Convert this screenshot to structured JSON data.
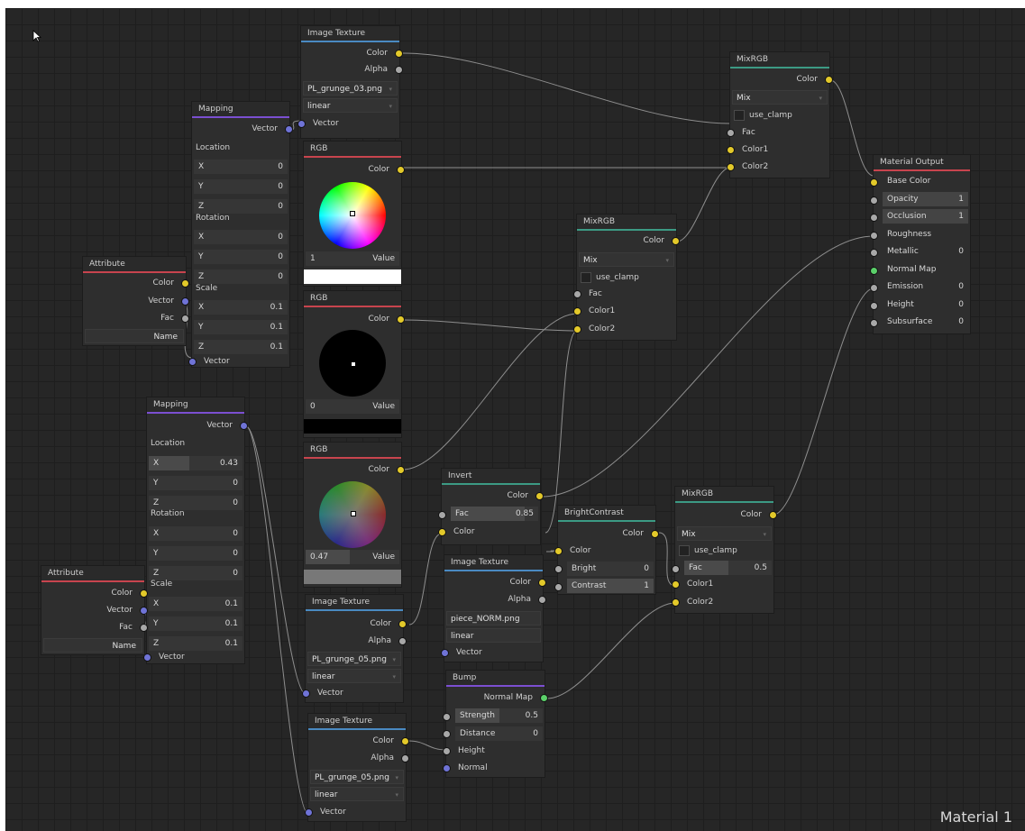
{
  "canvas_label": "Material 1",
  "cursor_icon": "arrow-cursor-icon",
  "socket_colors": {
    "color": "#e3c92a",
    "float": "#a8a8a8",
    "vector": "#6f73d6",
    "normal": "#5bd06a"
  },
  "nodes": {
    "image_texture_1": {
      "title": "Image Texture",
      "accent": "#4a8ac2",
      "out_color": "Color",
      "out_alpha": "Alpha",
      "file": "PL_grunge_03.png",
      "interp": "linear",
      "in_vector": "Vector"
    },
    "mapping_1": {
      "title": "Mapping",
      "accent": "#7b4fd1",
      "out_vector": "Vector",
      "location": "Location",
      "rotation": "Rotation",
      "scale": "Scale",
      "loc": [
        {
          "l": "X",
          "v": "0"
        },
        {
          "l": "Y",
          "v": "0"
        },
        {
          "l": "Z",
          "v": "0"
        }
      ],
      "rot": [
        {
          "l": "X",
          "v": "0"
        },
        {
          "l": "Y",
          "v": "0"
        },
        {
          "l": "Z",
          "v": "0"
        }
      ],
      "scl": [
        {
          "l": "X",
          "v": "0.1"
        },
        {
          "l": "Y",
          "v": "0.1"
        },
        {
          "l": "Z",
          "v": "0.1"
        }
      ],
      "in_vector": "Vector"
    },
    "attribute_1": {
      "title": "Attribute",
      "accent": "#c8444e",
      "color": "Color",
      "vector": "Vector",
      "fac": "Fac",
      "name": "Name"
    },
    "rgb_1": {
      "title": "RGB",
      "accent": "#c8444e",
      "out": "Color",
      "value_num": "1",
      "value_label": "Value",
      "swatch": "#ffffff"
    },
    "rgb_2": {
      "title": "RGB",
      "accent": "#c8444e",
      "out": "Color",
      "value_num": "0",
      "value_label": "Value",
      "swatch": "#000000"
    },
    "rgb_3": {
      "title": "RGB",
      "accent": "#c8444e",
      "out": "Color",
      "value_num": "0.47",
      "value_label": "Value",
      "swatch": "#787878"
    },
    "mixrgb_1": {
      "title": "MixRGB",
      "accent": "#3c9a84",
      "out": "Color",
      "mode": "Mix",
      "clamp": "use_clamp",
      "fac": "Fac",
      "color1": "Color1",
      "color2": "Color2"
    },
    "mixrgb_2": {
      "title": "MixRGB",
      "accent": "#3c9a84",
      "out": "Color",
      "mode": "Mix",
      "clamp": "use_clamp",
      "fac": "Fac",
      "color1": "Color1",
      "color2": "Color2"
    },
    "mixrgb_3": {
      "title": "MixRGB",
      "accent": "#3c9a84",
      "out": "Color",
      "mode": "Mix",
      "clamp": "use_clamp",
      "fac": "Fac",
      "fac_value": "0.5",
      "color1": "Color1",
      "color2": "Color2"
    },
    "material_output": {
      "title": "Material Output",
      "accent": "#c8444e",
      "inputs": [
        {
          "l": "Base Color",
          "v": ""
        },
        {
          "l": "Opacity",
          "v": "1"
        },
        {
          "l": "Occlusion",
          "v": "1"
        },
        {
          "l": "Roughness",
          "v": ""
        },
        {
          "l": "Metallic",
          "v": "0"
        },
        {
          "l": "Normal Map",
          "v": ""
        },
        {
          "l": "Emission",
          "v": "0"
        },
        {
          "l": "Height",
          "v": "0"
        },
        {
          "l": "Subsurface",
          "v": "0"
        }
      ]
    },
    "mapping_2": {
      "title": "Mapping",
      "accent": "#7b4fd1",
      "out_vector": "Vector",
      "location": "Location",
      "rotation": "Rotation",
      "scale": "Scale",
      "loc": [
        {
          "l": "X",
          "v": "0.43"
        },
        {
          "l": "Y",
          "v": "0"
        },
        {
          "l": "Z",
          "v": "0"
        }
      ],
      "rot": [
        {
          "l": "X",
          "v": "0"
        },
        {
          "l": "Y",
          "v": "0"
        },
        {
          "l": "Z",
          "v": "0"
        }
      ],
      "scl": [
        {
          "l": "X",
          "v": "0.1"
        },
        {
          "l": "Y",
          "v": "0.1"
        },
        {
          "l": "Z",
          "v": "0.1"
        }
      ],
      "in_vector": "Vector"
    },
    "attribute_2": {
      "title": "Attribute",
      "accent": "#c8444e",
      "color": "Color",
      "vector": "Vector",
      "fac": "Fac",
      "name": "Name"
    },
    "invert": {
      "title": "Invert",
      "accent": "#3c9a84",
      "out": "Color",
      "fac": "Fac",
      "fac_value": "0.85",
      "color": "Color"
    },
    "bright_contrast": {
      "title": "BrightContrast",
      "accent": "#3c9a84",
      "out": "Color",
      "color": "Color",
      "bright": "Bright",
      "bright_value": "0",
      "contrast": "Contrast",
      "contrast_value": "1"
    },
    "image_texture_2": {
      "title": "Image Texture",
      "accent": "#4a8ac2",
      "out_color": "Color",
      "out_alpha": "Alpha",
      "file": "piece_NORM.png",
      "interp": "linear",
      "in_vector": "Vector"
    },
    "image_texture_3": {
      "title": "Image Texture",
      "accent": "#4a8ac2",
      "out_color": "Color",
      "out_alpha": "Alpha",
      "file": "PL_grunge_05.png",
      "interp": "linear",
      "in_vector": "Vector"
    },
    "image_texture_4": {
      "title": "Image Texture",
      "accent": "#4a8ac2",
      "out_color": "Color",
      "out_alpha": "Alpha",
      "file": "PL_grunge_05.png",
      "interp": "linear",
      "in_vector": "Vector"
    },
    "bump": {
      "title": "Bump",
      "accent": "#7b4fd1",
      "out": "Normal Map",
      "strength": "Strength",
      "strength_value": "0.5",
      "distance": "Distance",
      "distance_value": "0",
      "height": "Height",
      "normal": "Normal"
    }
  }
}
